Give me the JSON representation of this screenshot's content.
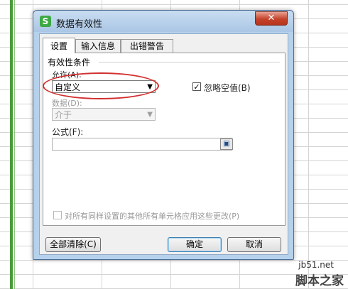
{
  "dialog": {
    "title": "数据有效性",
    "app_icon_letter": "S",
    "close_symbol": "✕"
  },
  "tabs": [
    {
      "label": "设置",
      "active": true
    },
    {
      "label": "输入信息",
      "active": false
    },
    {
      "label": "出错警告",
      "active": false
    }
  ],
  "settings": {
    "group_title": "有效性条件",
    "allow_label": "允许(A):",
    "allow_value": "自定义",
    "ignore_blank_label": "忽略空值(B)",
    "ignore_blank_checked": true,
    "data_label": "数据(D):",
    "data_value": "介于",
    "formula_label": "公式(F):",
    "formula_value": "",
    "apply_all_label": "对所有同样设置的其他所有单元格应用这些更改(P)",
    "apply_all_checked": false
  },
  "buttons": {
    "clear_all": "全部清除(C)",
    "ok": "确定",
    "cancel": "取消"
  },
  "watermark": {
    "site": "jb51.net",
    "name": "脚本之家"
  },
  "colors": {
    "annotation_ellipse": "#d23030",
    "selection_border": "#4a9a3a",
    "close_button": "#c4422b"
  }
}
